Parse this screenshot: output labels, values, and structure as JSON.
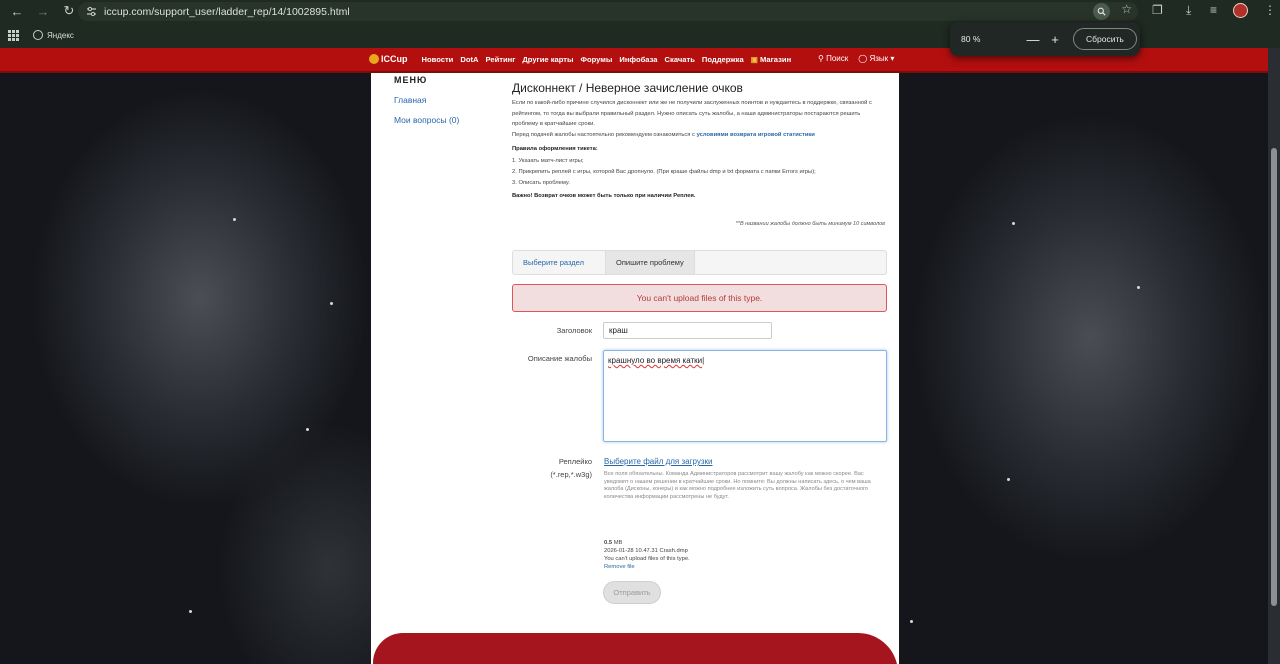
{
  "browser": {
    "url": "iccup.com/support_user/ladder_rep/14/1002895.html",
    "bookmark_yandex": "Яндекс",
    "zoom_level": "80 %",
    "zoom_minus": "—",
    "zoom_plus": "+",
    "zoom_reset": "Сбросить"
  },
  "nav": {
    "logo": "ICCup",
    "items": [
      "Новости",
      "DotA",
      "Рейтинг",
      "Другие карты",
      "Форумы",
      "Инфобаза",
      "Скачать",
      "Поддержка",
      "Магазин"
    ],
    "search": "Поиск",
    "language": "Язык"
  },
  "menu": {
    "heading": "МЕНЮ",
    "home": "Главная",
    "my_questions": "Мои вопросы (0)"
  },
  "main": {
    "title": "Дисконнект / Неверное зачисление очков",
    "intro": "Если по какой-либо причине случился дисконнект или же не получили заслуженных поинтов и нуждаетесь в поддержке, связанной с рейтингом, то тогда вы выбрали правильный раздел. Нужно описать суть жалобы, а наши администраторы постараются решить проблему в кратчайшие сроки.",
    "before_prefix": "Перед подачей жалобы настоятельно рекомендуем ознакомиться с ",
    "before_link": "условиями возврата игровой статистики",
    "rules_heading": "Правила оформления тикета:",
    "rule1": "1. Указать матч-лист игры;",
    "rule2": "2. Прикрепить реплей с игры, которой Вас дропнуло. (При краше файлы dmp и txt формата с папки Errors игры);",
    "rule3": "3. Описать проблему.",
    "important": "Важно! Возврат очков может быть только при наличии Реплея.",
    "note": "**В названии жалобы должно быть минимум 10 символов",
    "tab_section": "Выберите раздел",
    "tab_problem": "Опишите проблему",
    "error": "You can't upload files of this type.",
    "title_label": "Заголовок",
    "title_value": "краш",
    "desc_label": "Описание жалобы",
    "desc_value": "крашнуло во время катки",
    "replay_label": "Реплейко",
    "replay_ext": "(*.rep,*.w3g)",
    "upload_link": "Выберите файл для загрузки",
    "upload_help": "Все поля обязательны. Команда Администраторов рассмотрит вашу жалобу как можно скорее. Вас уведомят о нашем решении в кратчайшие сроки. Но помните: Вы должны написать здесь, о чем ваша жалоба (Дисконы, конеры) и как можно подробнее изложить суть вопроса. Жалобы без достаточного количества информации рассмотрены не будут.",
    "file_size_num": "0.5",
    "file_size_unit": "MB",
    "file_name": "2026-01-28 10.47.31 Crash.dmp",
    "file_error": "You can't upload files of this type.",
    "remove_file": "Remove file",
    "submit": "Отправить"
  }
}
